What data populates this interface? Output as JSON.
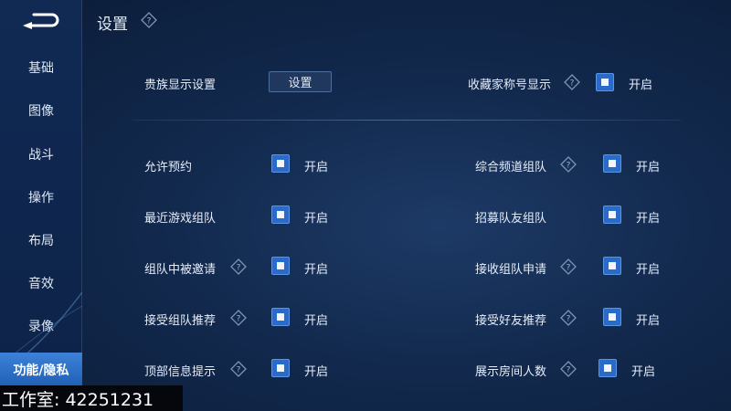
{
  "header": {
    "title": "设置"
  },
  "sidebar": {
    "items": [
      {
        "label": "基础"
      },
      {
        "label": "图像"
      },
      {
        "label": "战斗"
      },
      {
        "label": "操作"
      },
      {
        "label": "布局"
      },
      {
        "label": "音效"
      },
      {
        "label": "录像"
      },
      {
        "label": "功能/隐私",
        "active": true
      }
    ]
  },
  "settings": {
    "noble": {
      "label": "贵族显示设置",
      "button": "设置"
    },
    "collector": {
      "label": "收藏家称号显示",
      "state": "开启",
      "checked": true
    },
    "left": [
      {
        "label": "允许预约",
        "state": "开启",
        "checked": true
      },
      {
        "label": "最近游戏组队",
        "state": "开启",
        "checked": true
      },
      {
        "label": "组队中被邀请",
        "state": "开启",
        "checked": true,
        "help": true
      },
      {
        "label": "接受组队推荐",
        "state": "开启",
        "checked": true,
        "help": true
      },
      {
        "label": "顶部信息提示",
        "state": "开启",
        "checked": true,
        "help": true
      }
    ],
    "right": [
      {
        "label": "综合频道组队",
        "state": "开启",
        "checked": true,
        "help": true
      },
      {
        "label": "招募队友组队",
        "state": "开启",
        "checked": true
      },
      {
        "label": "接收组队申请",
        "state": "开启",
        "checked": true,
        "help": true
      },
      {
        "label": "接受好友推荐",
        "state": "开启",
        "checked": true,
        "help": true
      },
      {
        "label": "展示房间人数",
        "state": "开启",
        "checked": true,
        "help": true
      }
    ]
  },
  "watermark": {
    "text": "工作室: 42251231"
  },
  "colors": {
    "accent": "#2a6bc9",
    "active_tab": "#3d82d8",
    "background": "#12294d"
  }
}
